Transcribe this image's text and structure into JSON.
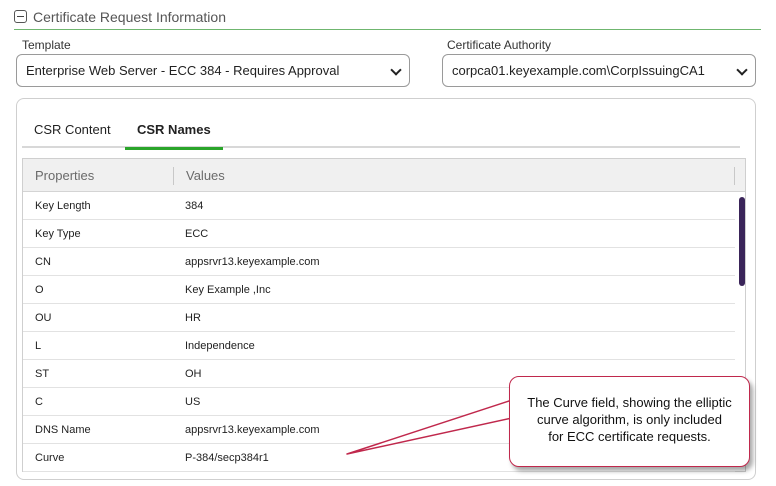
{
  "section": {
    "title": "Certificate Request Information"
  },
  "template": {
    "label": "Template",
    "value": "Enterprise Web Server - ECC 384 - Requires Approval"
  },
  "authority": {
    "label": "Certificate Authority",
    "value": "corpca01.keyexample.com\\CorpIssuingCA1"
  },
  "tabs": [
    {
      "label": "CSR Content",
      "active": false
    },
    {
      "label": "CSR Names",
      "active": true
    }
  ],
  "grid": {
    "headers": [
      "Properties",
      "Values"
    ],
    "rows": [
      {
        "property": "Key Length",
        "value": "384"
      },
      {
        "property": "Key Type",
        "value": "ECC"
      },
      {
        "property": "CN",
        "value": "appsrvr13.keyexample.com"
      },
      {
        "property": "O",
        "value": "Key Example ,Inc"
      },
      {
        "property": "OU",
        "value": "HR"
      },
      {
        "property": "L",
        "value": "Independence"
      },
      {
        "property": "ST",
        "value": "OH"
      },
      {
        "property": "C",
        "value": "US"
      },
      {
        "property": "DNS Name",
        "value": "appsrvr13.keyexample.com"
      },
      {
        "property": "Curve",
        "value": "P-384/secp384r1"
      }
    ]
  },
  "callout": {
    "line1": "The Curve field, showing the elliptic",
    "line2": "curve algorithm, is only included",
    "line3": "for ECC certificate requests."
  },
  "colors": {
    "accent": "#2aa52a",
    "callout_border": "#c0284c",
    "scrollbar": "#3a2459"
  }
}
